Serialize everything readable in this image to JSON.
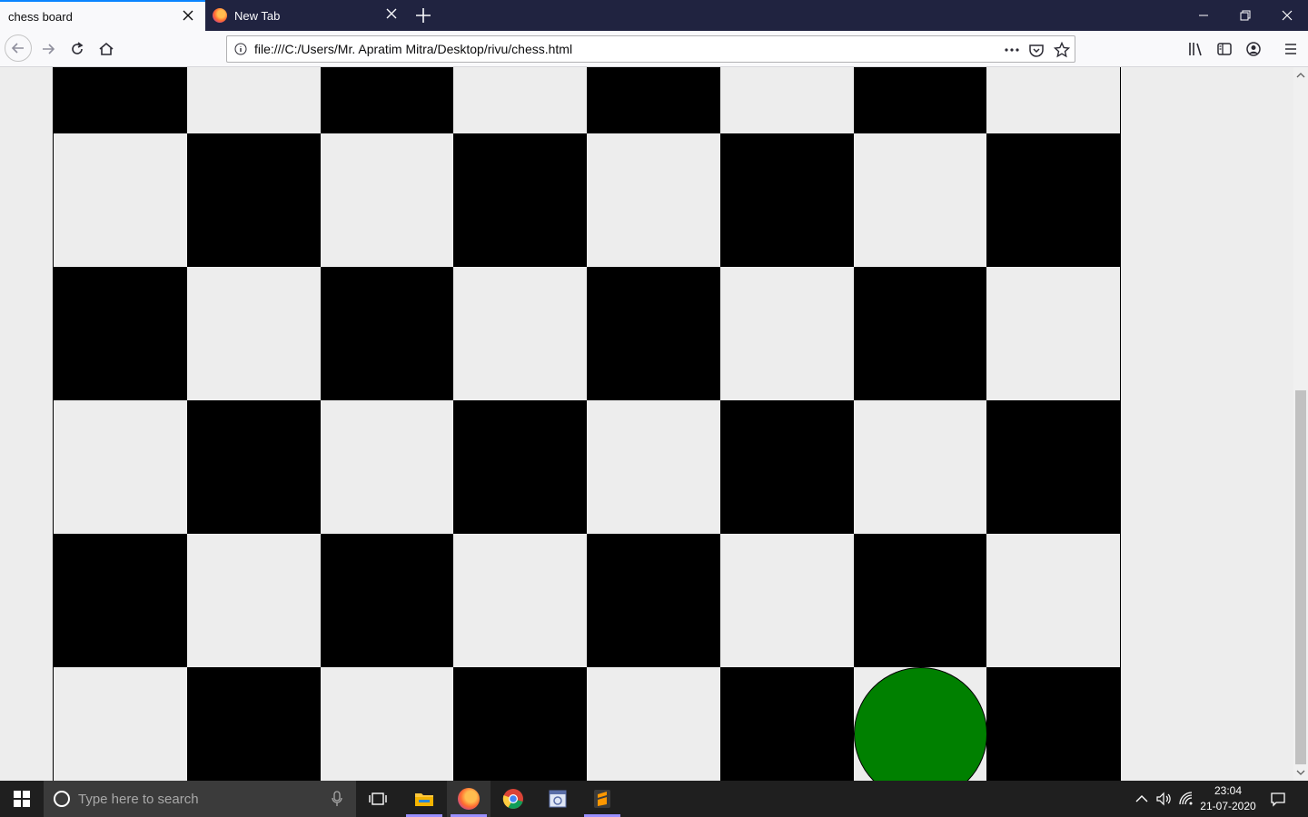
{
  "browser": {
    "tabs": [
      {
        "title": "chess board",
        "active": true
      },
      {
        "title": "New Tab",
        "active": false
      }
    ],
    "url": "file:///C:/Users/Mr. Apratim Mitra/Desktop/rivu/chess.html"
  },
  "board": {
    "dark_color": "#000000",
    "light_color": "#ededed",
    "piece_color": "#008000",
    "rows": [
      [
        "dark",
        "light",
        "dark",
        "light",
        "dark",
        "light",
        "dark",
        "light"
      ],
      [
        "light",
        "dark",
        "light",
        "dark",
        "light",
        "dark",
        "light",
        "dark"
      ],
      [
        "dark",
        "light",
        "dark",
        "light",
        "dark",
        "light",
        "dark",
        "light"
      ],
      [
        "light",
        "dark",
        "light",
        "dark",
        "light",
        "dark",
        "light",
        "dark"
      ],
      [
        "dark",
        "light",
        "dark",
        "light",
        "dark",
        "light",
        "dark",
        "light"
      ],
      [
        "light",
        "dark",
        "light",
        "dark",
        "light",
        "dark",
        "light",
        "dark"
      ]
    ],
    "piece": {
      "row": 5,
      "col": 6,
      "shape": "circle"
    }
  },
  "taskbar": {
    "search_placeholder": "Type here to search",
    "time": "23:04",
    "date": "21-07-2020",
    "apps": [
      "task-view-icon",
      "file-explorer-icon",
      "firefox-icon",
      "chrome-icon",
      "notepad-app-icon",
      "sublime-text-icon"
    ]
  }
}
